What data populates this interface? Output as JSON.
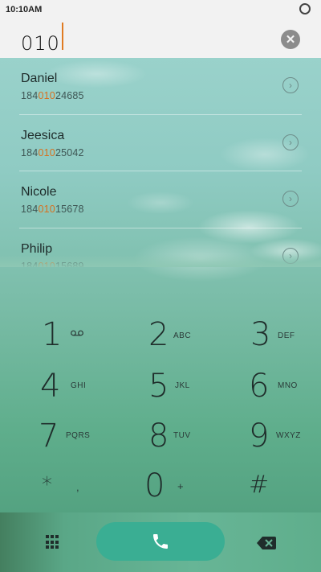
{
  "status_bar": {
    "time": "10:10AM"
  },
  "search": {
    "query": "010"
  },
  "contacts": [
    {
      "name": "Daniel",
      "prefix": "184",
      "match": "010",
      "suffix": "24685"
    },
    {
      "name": "Jeesica",
      "prefix": "184",
      "match": "010",
      "suffix": "25042"
    },
    {
      "name": "Nicole",
      "prefix": "184",
      "match": "010",
      "suffix": "15678"
    },
    {
      "name": "Philip",
      "prefix": "184",
      "match": "010",
      "suffix": "15689"
    }
  ],
  "keypad": {
    "k1": {
      "digit": "1",
      "letters": "oo"
    },
    "k2": {
      "digit": "2",
      "letters": "ABC"
    },
    "k3": {
      "digit": "3",
      "letters": "DEF"
    },
    "k4": {
      "digit": "4",
      "letters": "GHI"
    },
    "k5": {
      "digit": "5",
      "letters": "JKL"
    },
    "k6": {
      "digit": "6",
      "letters": "MNO"
    },
    "k7": {
      "digit": "7",
      "letters": "PQRS"
    },
    "k8": {
      "digit": "8",
      "letters": "TUV"
    },
    "k9": {
      "digit": "9",
      "letters": "WXYZ"
    },
    "kstar": {
      "digit": "*",
      "letters": ","
    },
    "k0": {
      "digit": "0",
      "letters": "+"
    },
    "khash": {
      "digit": "#",
      "letters": ""
    }
  },
  "icons": {
    "status_ring": "loading-ring-icon",
    "clear": "clear-icon",
    "contact_arrow": "chevron-right-icon",
    "keypad_toggle": "dialpad-grid-icon",
    "call": "phone-icon",
    "backspace": "backspace-icon"
  },
  "colors": {
    "highlight": "#d96f1c",
    "call_button": "#3aae93",
    "cursor": "#e07b22"
  }
}
